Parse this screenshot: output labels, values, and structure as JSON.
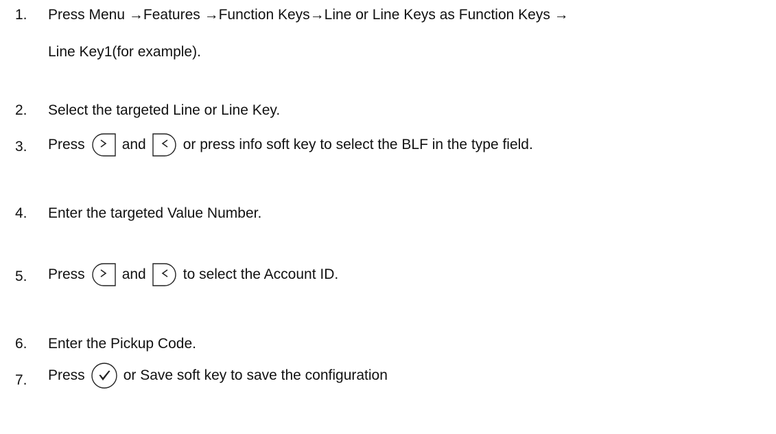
{
  "steps": [
    {
      "number": "1.",
      "line1": "Press Menu →Features →Function Keys→Line or Line Keys as Function Keys →",
      "line2": "Line Key1(for example)."
    },
    {
      "number": "2.",
      "text": "Select the targeted Line or Line Key."
    },
    {
      "number": "3.",
      "part1": "Press",
      "part2": "and",
      "part3": "or press info soft key to select the BLF in the type field.",
      "icons": [
        "right-arrow-key-icon",
        "left-arrow-key-icon"
      ]
    },
    {
      "number": "4.",
      "text": "Enter the targeted Value Number."
    },
    {
      "number": "5.",
      "part1": "Press",
      "part2": "and",
      "part3": "to select the Account ID.",
      "icons": [
        "right-arrow-key-icon",
        "left-arrow-key-icon"
      ]
    },
    {
      "number": "6.",
      "text": "Enter the Pickup Code."
    },
    {
      "number": "7.",
      "part1": "Press",
      "part2": "or Save soft key to save the configuration",
      "icons": [
        "ok-check-key-icon"
      ]
    }
  ]
}
